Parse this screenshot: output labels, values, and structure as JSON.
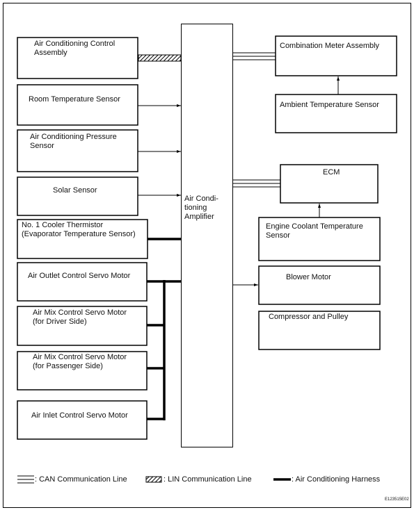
{
  "amplifier": {
    "label": "Air Conditioning Amplifier",
    "lines": [
      "Air Condi-",
      "tioning",
      "Amplifier"
    ]
  },
  "left_boxes": [
    {
      "label": "Air Conditioning Control Assembly",
      "lines": [
        "Air Conditioning Control",
        "Assembly"
      ],
      "connection": "LIN"
    },
    {
      "label": "Room Temperature Sensor",
      "lines": [
        "Room Temperature Sensor"
      ],
      "connection": "arrow"
    },
    {
      "label": "Air Conditioning Pressure Sensor",
      "lines": [
        "Air Conditioning Pressure",
        "Sensor"
      ],
      "connection": "arrow"
    },
    {
      "label": "Solar Sensor",
      "lines": [
        "Solar Sensor"
      ],
      "connection": "arrow"
    },
    {
      "label": "No. 1 Cooler Thermistor (Evaporator Temperature Sensor)",
      "lines": [
        "No. 1 Cooler Thermistor",
        "(Evaporator Temperature Sensor)"
      ],
      "connection": "harness"
    },
    {
      "label": "Air Outlet Control Servo Motor",
      "lines": [
        "Air Outlet Control Servo Motor"
      ],
      "connection": "harness"
    },
    {
      "label": "Air Mix Control Servo Motor (for Driver Side)",
      "lines": [
        "Air Mix Control Servo Motor",
        "(for Driver Side)"
      ],
      "connection": "harness"
    },
    {
      "label": "Air Mix Control Servo Motor (for Passenger Side)",
      "lines": [
        "Air Mix Control Servo Motor",
        "(for Passenger Side)"
      ],
      "connection": "harness"
    },
    {
      "label": "Air Inlet Control Servo Motor",
      "lines": [
        "Air Inlet Control Servo Motor"
      ],
      "connection": "harness"
    }
  ],
  "right_boxes": [
    {
      "label": "Combination Meter Assembly",
      "lines": [
        "Combination Meter Assembly"
      ],
      "connection": "CAN"
    },
    {
      "label": "Ambient Temperature Sensor",
      "lines": [
        "Ambient Temperature Sensor"
      ],
      "connection": "arrow to Combination Meter Assembly"
    },
    {
      "label": "ECM",
      "lines": [
        "ECM"
      ],
      "connection": "CAN"
    },
    {
      "label": "Engine Coolant Temperature Sensor",
      "lines": [
        "Engine Coolant Temperature",
        "Sensor"
      ],
      "connection": "arrow to ECM"
    },
    {
      "label": "Blower Motor",
      "lines": [
        "Blower Motor"
      ],
      "connection": "arrow from amplifier"
    },
    {
      "label": "Compressor and Pulley",
      "lines": [
        "Compressor and Pulley"
      ],
      "connection": "none"
    }
  ],
  "legend": [
    {
      "symbol": "double-line",
      "label": ": CAN Communication Line"
    },
    {
      "symbol": "hatched-bar",
      "label": ": LIN Communication Line"
    },
    {
      "symbol": "thick-line",
      "label": ": Air Conditioning Harness"
    }
  ],
  "figure_code": "E123515E02"
}
